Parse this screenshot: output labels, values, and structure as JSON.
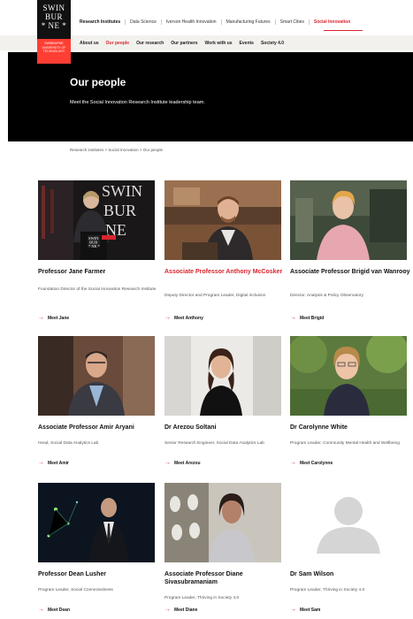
{
  "logo": {
    "line1": "SWIN",
    "line2": "BUR",
    "line3": "* NE *",
    "sub": "SWINBURNE UNIVERSITY OF TECHNOLOGY"
  },
  "nav_primary": [
    "Research Institutes",
    "Data Science",
    "Iverson Health Innovation",
    "Manufacturing Futures",
    "Smart Cities",
    "Social Innovation"
  ],
  "nav_secondary": [
    "About us",
    "Our people",
    "Our research",
    "Our partners",
    "Work with us",
    "Events",
    "Society 4.0"
  ],
  "hero": {
    "title": "Our people",
    "subtitle": "Meet the Social Innovation Research Institute leadership team."
  },
  "breadcrumb": "Research institutes > Social Innovation > Our people",
  "people": [
    {
      "name": "Professor Jane Farmer",
      "role": "Foundation Director of the Social Innovation Research Institute",
      "link": "Meet Jane",
      "highlight": false
    },
    {
      "name": "Associate Professor Anthony McCosker",
      "role": "Deputy Director and Program Leader, Digital inclusion",
      "link": "Meet Anthony",
      "highlight": true
    },
    {
      "name": "Associate Professor Brigid van Wanrooy",
      "role": "Director, Analysis & Policy Observatory",
      "link": "Meet Brigid",
      "highlight": false
    },
    {
      "name": "Associate Professor Amir Aryani",
      "role": "Head, Social Data Analytics Lab",
      "link": "Meet Amir",
      "highlight": false
    },
    {
      "name": "Dr Arezou Soltani",
      "role": "Senior Research Engineer, Social Data Analytics Lab",
      "link": "Meet Arezou",
      "highlight": false
    },
    {
      "name": "Dr Carolynne White",
      "role": "Program Leader, Community Mental Health and Wellbeing",
      "link": "Meet Carolynne",
      "highlight": false
    },
    {
      "name": "Professor Dean Lusher",
      "role": "Program Leader, Social Connectedness",
      "link": "Meet Dean",
      "highlight": false
    },
    {
      "name": "Associate Professor Diane Sivasubramaniam",
      "role": "Program Leader, Thriving in Society 4.0",
      "link": "Meet Diane",
      "highlight": false
    },
    {
      "name": "Dr Sam Wilson",
      "role": "Program Leader, Thriving in Society 4.0",
      "link": "Meet Sam",
      "highlight": false
    }
  ],
  "podium_sign": {
    "line1": "SWIN",
    "line2": "BUR",
    "line3": "* NE *"
  }
}
